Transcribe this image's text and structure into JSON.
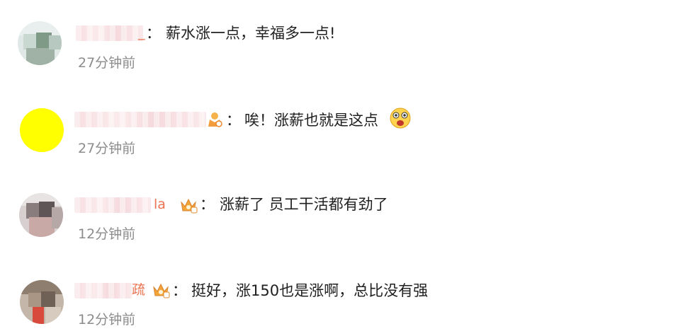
{
  "comments": [
    {
      "name_tail": "_",
      "text": "薪水涨一点，幸福多一点!",
      "time": "27分钟前"
    },
    {
      "name_tail": "",
      "text": "唉！涨薪也就是这点",
      "time": "27分钟前",
      "emoji": "surprised-face-emoji"
    },
    {
      "name_tail": "la",
      "text": "涨薪了 员工干活都有劲了",
      "time": "12分钟前"
    },
    {
      "name_tail": "疏",
      "text": "挺好，涨150也是涨啊，总比没有强",
      "time": "12分钟前"
    }
  ],
  "separator": "：",
  "badge_icon": "crown-badge-icon",
  "colors": {
    "time": "#8c8c8c",
    "username": "#eb7350",
    "text": "#1f1f1f"
  }
}
